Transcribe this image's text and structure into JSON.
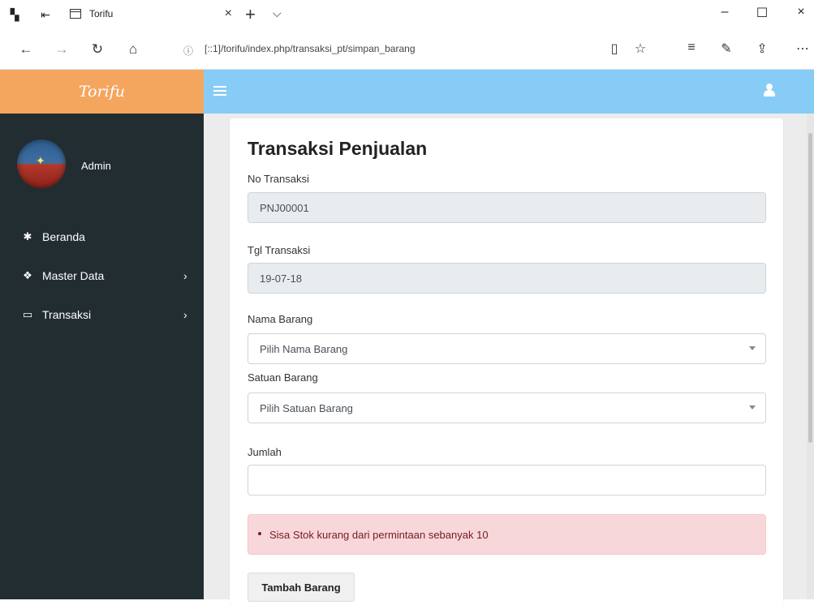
{
  "browser": {
    "tab_title": "Torifu",
    "url": "[::1]/torifu/index.php/transaksi_pt/simpan_barang"
  },
  "app": {
    "brand": "Torifu",
    "user_name": "Admin"
  },
  "sidebar": {
    "items": [
      {
        "label": "Beranda",
        "icon": "cogs-icon"
      },
      {
        "label": "Master Data",
        "icon": "cubes-icon",
        "arrow": "›"
      },
      {
        "label": "Transaksi",
        "icon": "desktop-icon",
        "arrow": "›"
      }
    ]
  },
  "form": {
    "title": "Transaksi Penjualan",
    "no_transaksi_label": "No Transaksi",
    "no_transaksi_value": "PNJ00001",
    "tgl_transaksi_label": "Tgl Transaksi",
    "tgl_transaksi_value": "19-07-18",
    "nama_barang_label": "Nama Barang",
    "nama_barang_placeholder": "Pilih Nama Barang",
    "satuan_barang_label": "Satuan Barang",
    "satuan_barang_placeholder": "Pilih Satuan Barang",
    "jumlah_label": "Jumlah",
    "jumlah_value": "",
    "alert_message": "Sisa Stok kurang dari permintaan sebanyak 10",
    "submit_label": "Tambah Barang"
  },
  "colors": {
    "brand": "#f4a65f",
    "topnav": "#87ccf6",
    "sidebar": "#222d32",
    "alert_bg": "#f8d7da",
    "alert_text": "#721c24"
  }
}
